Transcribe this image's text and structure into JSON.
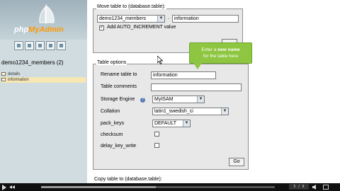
{
  "logo": {
    "brand_php": "php",
    "brand_my": "MyAdmin"
  },
  "left": {
    "db_name": "demo1234_members (2)",
    "tables": [
      {
        "label": "details"
      },
      {
        "label": "information"
      }
    ]
  },
  "move": {
    "legend": "Move table to (database.table):",
    "db_select": "demo1234_members",
    "separator": ".",
    "table_value": "information",
    "auto_increment_label": "Add AUTO_INCREMENT value",
    "auto_increment_checked": true
  },
  "tooltip": {
    "line1_pre": "Enter a ",
    "line1_bold": "new name",
    "line2": "for the table here"
  },
  "options": {
    "legend": "Table options",
    "rename_label": "Rename table to",
    "rename_value": "information",
    "comments_label": "Table comments",
    "comments_value": "",
    "engine_label": "Storage Engine",
    "engine_value": "MyISAM",
    "collation_label": "Collation",
    "collation_value": "latin1_swedish_ci",
    "pack_keys_label": "pack_keys",
    "pack_keys_value": "DEFAULT",
    "checksum_label": "checksum",
    "delay_key_write_label": "delay_key_write",
    "go_label": "Go"
  },
  "copy": {
    "legend": "Copy table to (database.table):"
  },
  "player": {
    "timecode": "5 / 9",
    "progress_fraction": 0.49
  }
}
